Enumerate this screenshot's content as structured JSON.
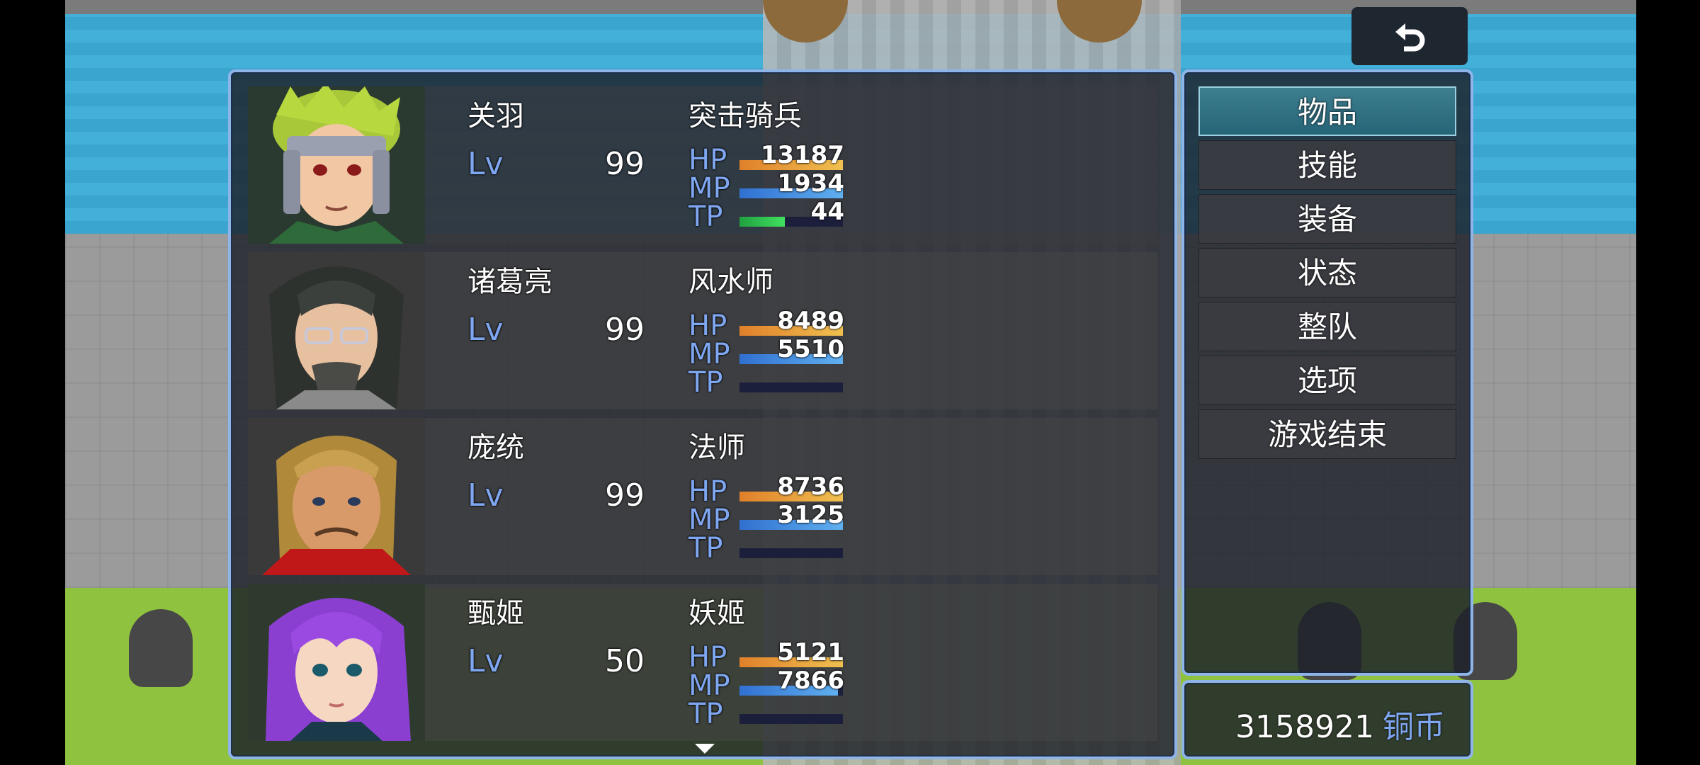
{
  "actors": [
    {
      "name": "关羽",
      "class": "突击骑兵",
      "lv_label": "Lv",
      "level": "99",
      "hp_label": "HP",
      "hp": "13187",
      "hp_fill": 1.0,
      "mp_label": "MP",
      "mp": "1934",
      "mp_fill": 1.0,
      "tp_label": "TP",
      "tp": "44",
      "tp_fill": 0.44
    },
    {
      "name": "诸葛亮",
      "class": "风水师",
      "lv_label": "Lv",
      "level": "99",
      "hp_label": "HP",
      "hp": "8489",
      "hp_fill": 1.0,
      "mp_label": "MP",
      "mp": "5510",
      "mp_fill": 1.0,
      "tp_label": "TP",
      "tp": "",
      "tp_fill": 0
    },
    {
      "name": "庞统",
      "class": "法师",
      "lv_label": "Lv",
      "level": "99",
      "hp_label": "HP",
      "hp": "8736",
      "hp_fill": 1.0,
      "mp_label": "MP",
      "mp": "3125",
      "mp_fill": 1.0,
      "tp_label": "TP",
      "tp": "",
      "tp_fill": 0
    },
    {
      "name": "甄姬",
      "class": "妖姬",
      "lv_label": "Lv",
      "level": "50",
      "hp_label": "HP",
      "hp": "5121",
      "hp_fill": 1.0,
      "mp_label": "MP",
      "mp": "7866",
      "mp_fill": 0.95,
      "tp_label": "TP",
      "tp": "",
      "tp_fill": 0
    }
  ],
  "menu": {
    "items": [
      "物品",
      "技能",
      "装备",
      "状态",
      "整队",
      "选项",
      "游戏结束"
    ],
    "selected_index": 0
  },
  "gold": {
    "amount": "3158921",
    "unit": "铜币"
  },
  "icons": {
    "back": "back-arrow-icon",
    "scroll": "scroll-down-arrow-icon"
  },
  "colors": {
    "hp_gradient": [
      "#e0802a",
      "#f0c050"
    ],
    "mp_gradient": [
      "#3070d0",
      "#60b0f0"
    ],
    "tp_gradient": [
      "#20a040",
      "#40e060"
    ],
    "system_blue": "#7fa6f0",
    "window_border": "#8fb4e8"
  }
}
